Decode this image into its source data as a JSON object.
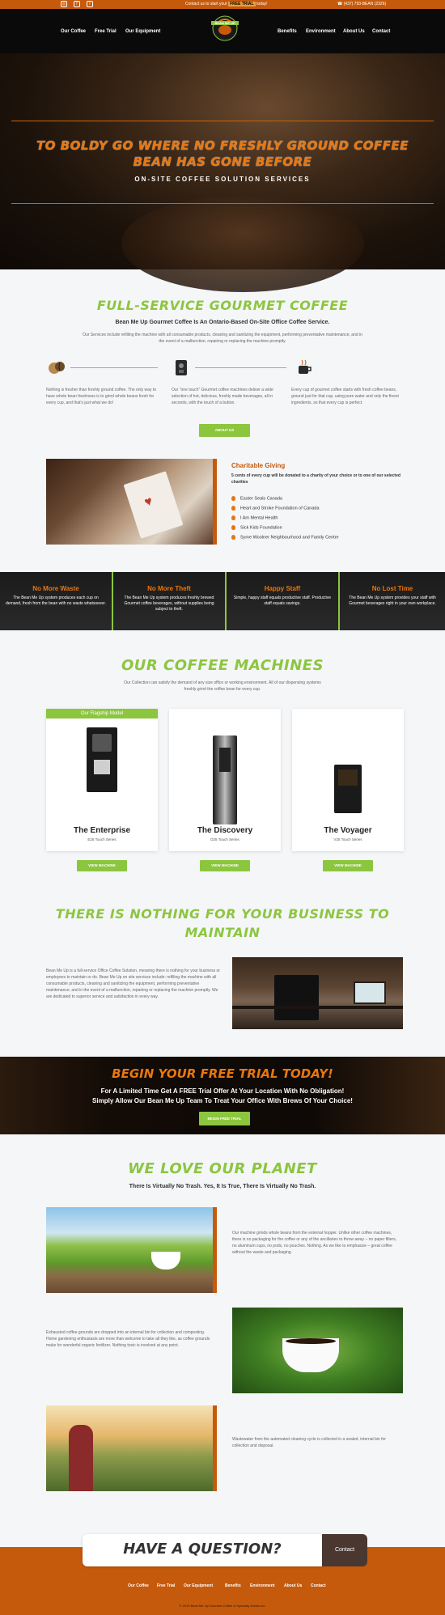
{
  "topbar": {
    "social": [
      "instagram-icon",
      "facebook-icon",
      "twitter-icon"
    ],
    "promo_pre": "Contact us to start your",
    "promo_hl": "FREE TRIAL",
    "promo_post": "today!",
    "phone": "(437) 793-BEAN (2326)"
  },
  "nav": {
    "left": [
      "Our Coffee",
      "Free Trial",
      "Our Equipment"
    ],
    "right": [
      "Benefits",
      "Environment",
      "About Us",
      "Contact"
    ],
    "logo_text": "BEAN ME UP"
  },
  "hero": {
    "title": "To Boldy Go Where No Freshly Ground Coffee Bean Has Gone Before",
    "subtitle": "ON-SITE COFFEE SOLUTION SERVICES"
  },
  "service": {
    "title": "Full-Service Gourmet Coffee",
    "subtitle": "Bean Me Up Gourmet Coffee Is An Ontario-Based On-Site Office Coffee Service.",
    "description": "Our Services include refilling the machine with all consumable products, cleaning and sanitizing the equipment, performing preventative maintenance, and in the event of a malfunction, repairing or replacing the machine promptly.",
    "features": [
      "Nothing is fresher than freshly ground coffee. The only way to have whole bean freshness is to grind whole beans fresh for every cup, and that's just what we do!",
      "Our \"one touch\" Gourmet coffee machines deliver a wide selection of hot, delicious, freshly made beverages, all in seconds, with the touch of a button.",
      "Every cup of gourmet coffee starts with fresh coffee beans, ground just for that cup, using pure water and only the finest ingredients, so that every cup is perfect."
    ],
    "button": "ABOUT US"
  },
  "charity": {
    "title": "Charitable Giving",
    "lead": "5 cents of every cup will be donated to a charity of your choice or to one of our selected charities",
    "items": [
      "Easter Seals Canada",
      "Heart and Stroke Foundation of Canada",
      "I Am Mental Health",
      "Sick Kids Foundation",
      "Syme Woolner Neighbourhood and Family Centre"
    ]
  },
  "values": [
    {
      "title": "No More Waste",
      "text": "The Bean Me Up system produces each cup on demand, fresh from the bean with no waste whatsoever."
    },
    {
      "title": "No More Theft",
      "text": "The Bean Me Up system produces freshly brewed Gourmet coffee beverages, without supplies being subject to theft."
    },
    {
      "title": "Happy Staff",
      "text": "Simple, happy staff equals productive staff. Productive staff equals savings."
    },
    {
      "title": "No Lost Time",
      "text": "The Bean Me Up system provides your staff with Gourmet beverages right in your own workplace."
    }
  ],
  "machines": {
    "title": "Our Coffee Machines",
    "description": "Our Collection can satisfy the demand of any size office or working environment. All of our dispensing systems freshly grind the coffee bean for every cup.",
    "flagship": "Our Flagship Model",
    "items": [
      {
        "name": "The Enterprise",
        "series": "E25 Touch Series",
        "button": "VIEW MACHINE"
      },
      {
        "name": "The Discovery",
        "series": "D25 Touch Series",
        "button": "VIEW MACHINE"
      },
      {
        "name": "The Voyager",
        "series": "V25 Touch Series",
        "button": "VIEW MACHINE"
      }
    ]
  },
  "maintain": {
    "title": "There Is Nothing For Your Business To Maintain",
    "text": "Bean Me Up is a full-service Office Coffee Solution, meaning there is nothing for your business or employees to maintain or do. Bean Me Up on site services include: refilling the machine with all consumable products, cleaning and sanitizing the equipment, performing preventative maintenance, and in the event of a malfunction, repairing or replacing the machine promptly. We are dedicated to superior service and satisfaction in every way."
  },
  "trial": {
    "title": "Begin Your Free Trial Today!",
    "line1": "For A Limited Time Get A FREE Trial Offer At Your Location With No Obligation!",
    "line2": "Simply Allow Our Bean Me Up Team To Treat Your Office With Brews Of Your Choice!",
    "button": "BEGIN FREE TRIAL"
  },
  "planet": {
    "title": "We Love Our Planet",
    "subtitle": "There Is Virtually No Trash. Yes, It Is True, There Is Virtually No Trash.",
    "blocks": [
      "Our machine grinds whole beans from the external hopper. Unlike other coffee machines, there is no packaging for the coffee or any of the ancillaries to throw away – no paper filters, no aluminum cups, no pods, no pouches. Nothing. As we like to emphasize – great coffee without the waste and packaging.",
      "Exhausted coffee grounds are dropped into an internal bin for collection and composting. Home gardening enthusiasts are more than welcome to take all they like, as coffee grounds make for wonderful organic fertilizer. Nothing toxic is involved at any point.",
      "Wastewater from the automated cleaning cycle is collected in a sealed, internal bin for collection and disposal."
    ]
  },
  "question": {
    "title": "Have A Question?",
    "button": "Contact"
  },
  "footer": {
    "links": [
      "Our Coffee",
      "Free Trial",
      "Our Equipment",
      "Benefits",
      "Environment",
      "About Us",
      "Contact"
    ],
    "copyright": "© 2019 Bean Me Up Gourmet Coffee & Specialty Drinks Inc."
  },
  "colors": {
    "orange": "#c65a0c",
    "green": "#8cc63f",
    "dark": "#0a0a0a"
  }
}
